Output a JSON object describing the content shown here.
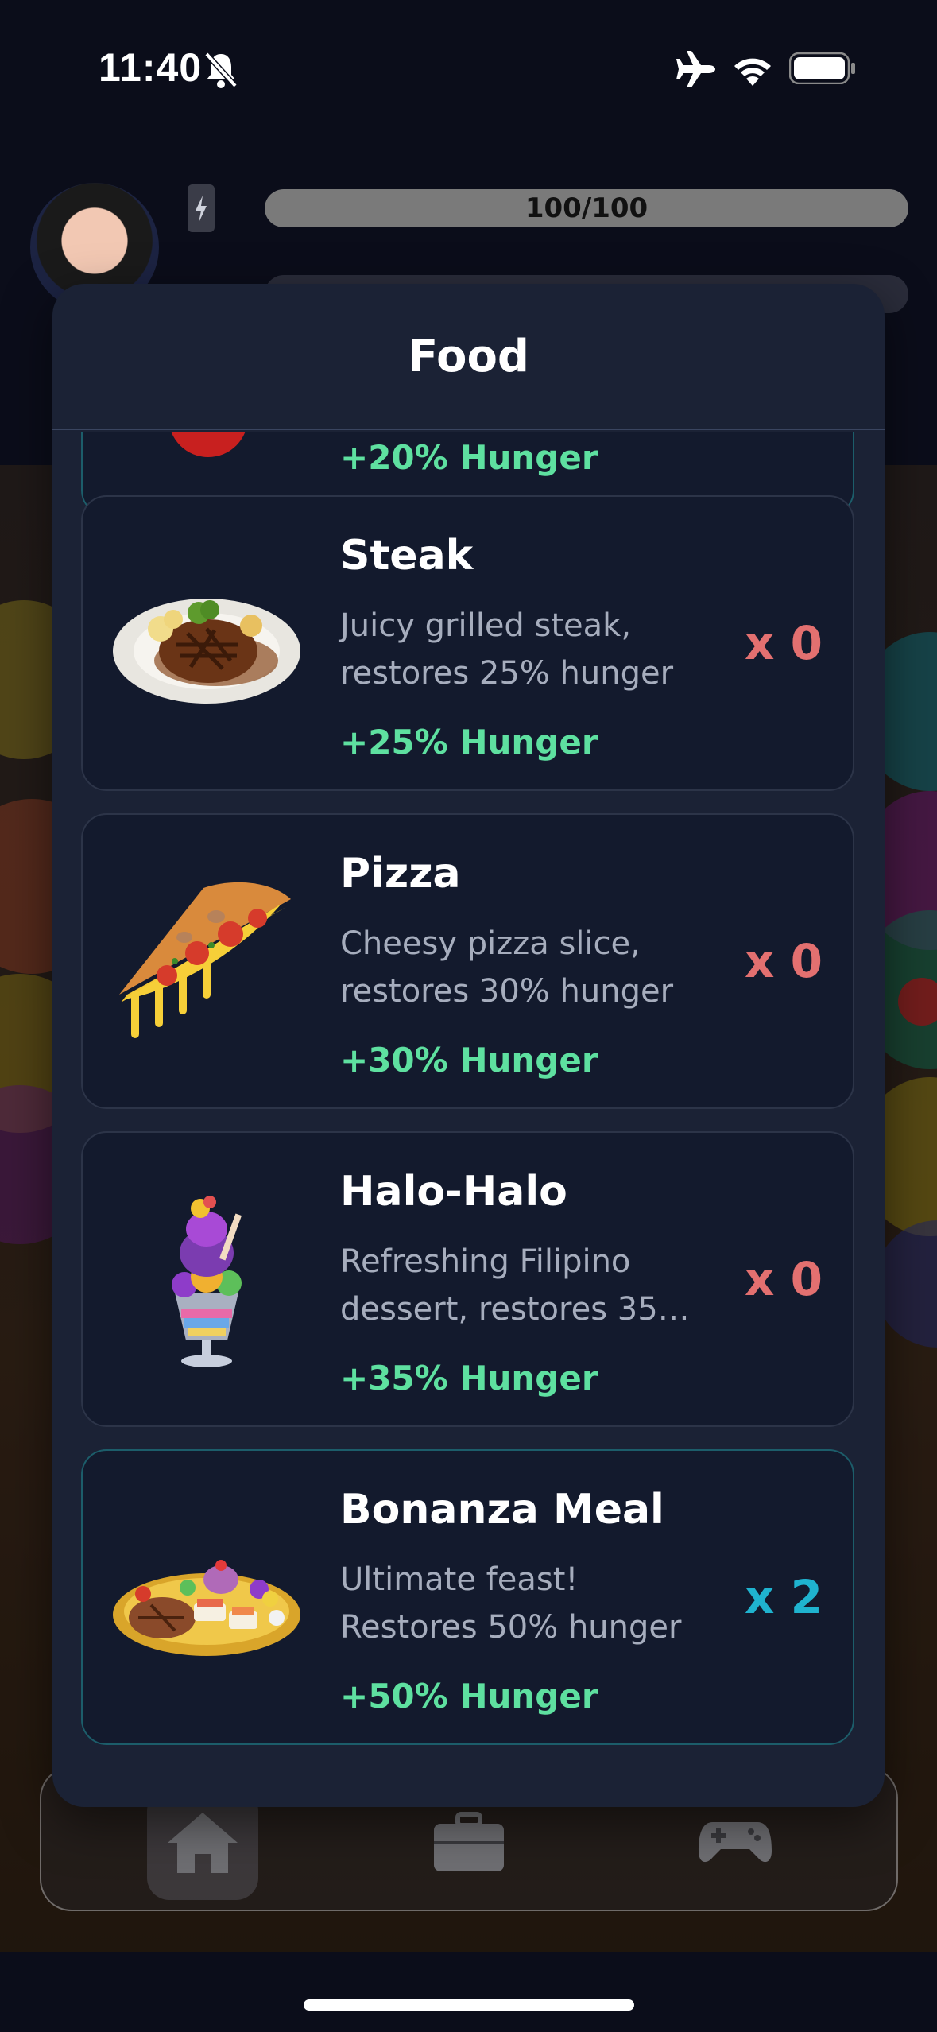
{
  "status": {
    "time": "11:40"
  },
  "header": {
    "energy_value": "100/100"
  },
  "modal": {
    "title": "Food",
    "items": [
      {
        "name": "",
        "description": "",
        "effect": "+20% Hunger",
        "qty": ""
      },
      {
        "name": "Steak",
        "description": "Juicy grilled steak, restores 25% hunger",
        "effect": "+25% Hunger",
        "qty": "x 0"
      },
      {
        "name": "Pizza",
        "description": "Cheesy pizza slice, restores 30% hunger",
        "effect": "+30% Hunger",
        "qty": "x 0"
      },
      {
        "name": "Halo-Halo",
        "description": "Refreshing Filipino dessert, restores 35…",
        "effect": "+35% Hunger",
        "qty": "x 0"
      },
      {
        "name": "Bonanza Meal",
        "description": "Ultimate feast! Restores 50% hunger",
        "effect": "+50% Hunger",
        "qty": "x 2"
      }
    ]
  },
  "nav": {
    "items": [
      "home-icon",
      "briefcase-icon",
      "gamepad-icon"
    ]
  },
  "colors": {
    "accent_teal": "#1fb3cf",
    "effect_green": "#5ee0a0",
    "qty_zero_red": "#e37070",
    "modal_bg": "#1b2235",
    "card_bg": "#131a2d"
  }
}
